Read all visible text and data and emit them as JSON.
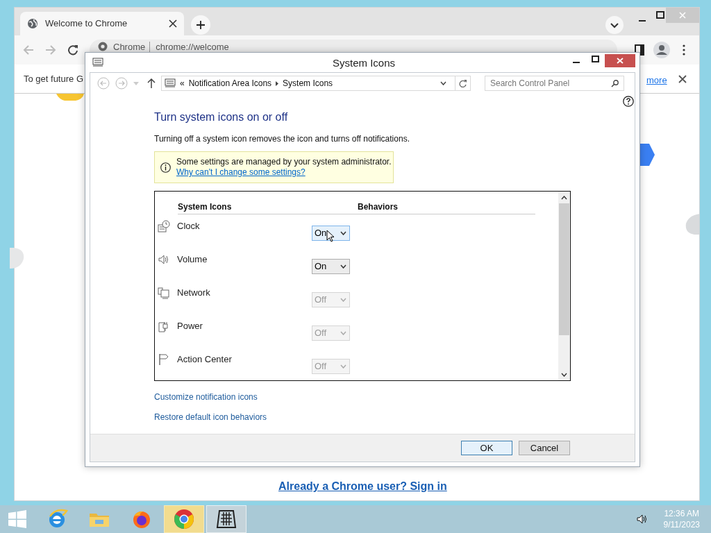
{
  "browser": {
    "tab_title": "Welcome to Chrome",
    "omnibox_site": "Chrome",
    "url": "chrome://welcome",
    "infobar_text": "To get future G",
    "infobar_link": "more",
    "sign_in_link": "Already a Chrome user? Sign in"
  },
  "dialog": {
    "title": "System Icons",
    "breadcrumb_prefix": "«",
    "breadcrumb": [
      "Notification Area Icons",
      "System Icons"
    ],
    "search": {
      "placeholder": "Search Control Panel"
    },
    "heading": "Turn system icons on or off",
    "description": "Turning off a system icon removes the icon and turns off notifications.",
    "notice": {
      "text": "Some settings are managed by your system administrator.",
      "link": "Why can't I change some settings?"
    },
    "columns": [
      "System Icons",
      "Behaviors"
    ],
    "rows": [
      {
        "kind": "clock",
        "name": "Clock",
        "behavior": "On",
        "disabled": false,
        "hovered": true
      },
      {
        "kind": "volume",
        "name": "Volume",
        "behavior": "On",
        "disabled": false,
        "hovered": false
      },
      {
        "kind": "network",
        "name": "Network",
        "behavior": "Off",
        "disabled": true,
        "hovered": false
      },
      {
        "kind": "power",
        "name": "Power",
        "behavior": "Off",
        "disabled": true,
        "hovered": false
      },
      {
        "kind": "flag",
        "name": "Action Center",
        "behavior": "Off",
        "disabled": true,
        "hovered": false
      }
    ],
    "links": [
      "Customize notification icons",
      "Restore default icon behaviors"
    ],
    "buttons": [
      {
        "label": "OK",
        "default": true
      },
      {
        "label": "Cancel",
        "default": false
      }
    ]
  },
  "taskbar": {
    "apps": [
      {
        "kind": "ie",
        "selected": false,
        "hovered": false
      },
      {
        "kind": "explorer",
        "selected": false,
        "hovered": false
      },
      {
        "kind": "firefox",
        "selected": false,
        "hovered": false
      },
      {
        "kind": "chrome",
        "selected": false,
        "hovered": true
      },
      {
        "kind": "controlpanel",
        "selected": true,
        "hovered": false
      }
    ],
    "time": "12:36 AM",
    "date": "9/11/2023"
  }
}
